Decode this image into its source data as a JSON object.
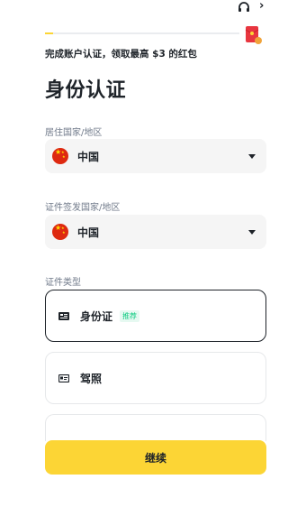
{
  "header": {
    "support_icon": "headset-icon",
    "close_icon": "close-icon",
    "reward_icon": "red-envelope-icon"
  },
  "progress": {
    "value": 0.04,
    "fill_color": "#fcd535"
  },
  "promo_text": "完成账户认证，领取最高 $3 的红包",
  "page_title": "身份认证",
  "residence": {
    "label": "居住国家/地区",
    "value": "中国",
    "flag_icon": "china-flag-icon"
  },
  "issuing": {
    "label": "证件签发国家/地区",
    "value": "中国",
    "flag_icon": "china-flag-icon"
  },
  "doc_type": {
    "label": "证件类型",
    "options": [
      {
        "label": "身份证",
        "badge": "推荐",
        "icon": "id-card-icon",
        "selected": true
      },
      {
        "label": "驾照",
        "icon": "driver-license-icon",
        "selected": false
      },
      {
        "label": "",
        "selected": false
      }
    ]
  },
  "continue_label": "继续",
  "colors": {
    "accent": "#fcd535",
    "text": "#1e2329",
    "muted": "#707a8a",
    "badge_green": "#0ecb81"
  }
}
